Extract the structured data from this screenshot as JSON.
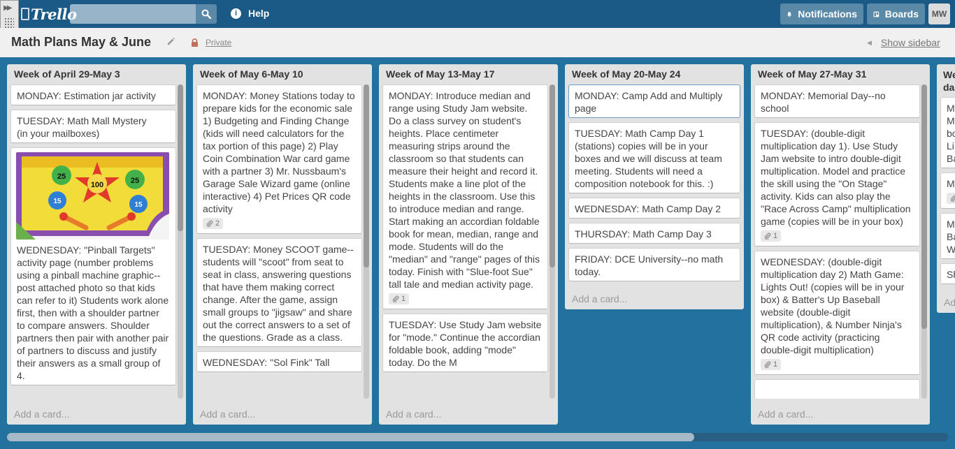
{
  "header": {
    "logo": "Trello",
    "search_value": "",
    "help": "Help",
    "notifications": "Notifications",
    "boards": "Boards",
    "avatar": "MW"
  },
  "board": {
    "title": "Math Plans May & June",
    "visibility": "Private",
    "show_sidebar": "Show sidebar"
  },
  "lists": [
    {
      "title": "Week of April 29-May 3",
      "add_card": "Add a card...",
      "cards": [
        {
          "text": "MONDAY: Estimation jar activity"
        },
        {
          "text": "TUESDAY: Math Mall Mystery\n(in your mailboxes)"
        },
        {
          "text": "WEDNESDAY: \"Pinball Targets\" activity page (number problems using a pinball machine graphic--post attached photo so that kids can refer to it) Students work alone first, then with a shoulder partner to compare answers. Shoulder partners then pair with another pair of partners to discuss and justify their answers as a small group of 4.",
          "image": true,
          "image_labels": [
            "25",
            "100",
            "25",
            "15",
            "15"
          ]
        }
      ]
    },
    {
      "title": "Week of May 6-May 10",
      "add_card": "Add a card...",
      "cards": [
        {
          "text": "MONDAY: Money Stations today to prepare kids for the economic sale 1) Budgeting and Finding Change (kids will need calculators for the tax portion of this page) 2) Play Coin Combination War card game with a partner 3) Mr. Nussbaum's Garage Sale Wizard game (online interactive) 4) Pet Prices QR code activity",
          "attachments": "2"
        },
        {
          "text": "TUESDAY: Money SCOOT game--students will \"scoot\" from seat to seat in class, answering questions that have them making correct change. After the game, assign small groups to \"jigsaw\" and share out the correct answers to a set of the questions. Grade as a class."
        },
        {
          "text": "WEDNESDAY: \"Sol Fink\" Tall"
        }
      ]
    },
    {
      "title": "Week of May 13-May 17",
      "add_card": "Add a card...",
      "cards": [
        {
          "text": "MONDAY: Introduce median and range using Study Jam website. Do a class survey on student's heights. Place centimeter measuring strips around the classroom so that students can measure their height and record it. Students make a line plot of the heights in the classroom. Use this to introduce median and range. Start making an accordian foldable book for mean, median, range and mode. Students will do the \"median\" and \"range\" pages of this today. Finish with \"Slue-foot Sue\" tall tale and median activity page.",
          "attachments": "1"
        },
        {
          "text": "TUESDAY: Use Study Jam website for \"mode.\" Continue the accordian foldable book, adding \"mode\" today. Do the M"
        }
      ]
    },
    {
      "title": "Week of May 20-May 24",
      "add_card": "Add a card...",
      "cards": [
        {
          "text": "MONDAY: Camp Add and Multiply page",
          "selected": true
        },
        {
          "text": "TUESDAY: Math Camp Day 1 (stations) copies will be in your boxes and we will discuss at team meeting. Students will need a composition notebook for this. :)"
        },
        {
          "text": "WEDNESDAY: Math Camp Day 2"
        },
        {
          "text": "THURSDAY: Math Camp Day 3"
        },
        {
          "text": "FRIDAY: DCE University--no math today."
        }
      ]
    },
    {
      "title": "Week of May 27-May 31",
      "add_card": "Add a card...",
      "cards": [
        {
          "text": "MONDAY: Memorial Day--no school"
        },
        {
          "text": "TUESDAY: (double-digit multiplication day 1). Use Study Jam website to intro double-digit multiplication. Model and practice the skill using the \"On Stage\" activity. Kids can also play the \"Race Across Camp\" multiplication game (copies will be in your box)",
          "attachments": "1"
        },
        {
          "text": "WEDNESDAY: (double-digit multiplication day 2) Math Game: Lights Out! (copies will be in your box) & Batter's Up Baseball website (double-digit multiplication), & Number Ninja's QR code activity (practicing double-digit multiplication)",
          "attachments": "1"
        },
        {
          "text": ""
        }
      ]
    },
    {
      "title": "We",
      "title_line2": "da",
      "add_card": "Ad",
      "cards": [
        {
          "text": "M\nM\nbo\nLi\nBa"
        },
        {
          "text": "M",
          "attachments": "1"
        },
        {
          "text": "M\nBa\nW"
        },
        {
          "text": "Sh"
        }
      ]
    }
  ]
}
